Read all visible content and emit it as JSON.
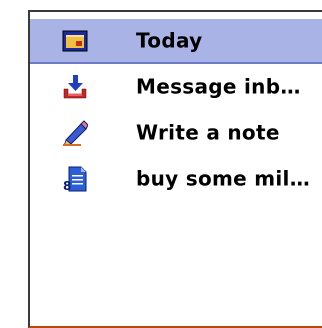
{
  "menu": {
    "items": [
      {
        "label": "Today",
        "icon": "calendar-icon",
        "selected": true
      },
      {
        "label": "Message inb…",
        "icon": "inbox-download-icon",
        "selected": false
      },
      {
        "label": "Write a note",
        "icon": "pencil-icon",
        "selected": false
      },
      {
        "label": "buy some mil…",
        "icon": "note-page-icon",
        "selected": false
      }
    ]
  },
  "colors": {
    "selection_bg": "#a9b3e6",
    "frame_bottom": "#b84a10",
    "frame_border": "#3a3a3a"
  }
}
